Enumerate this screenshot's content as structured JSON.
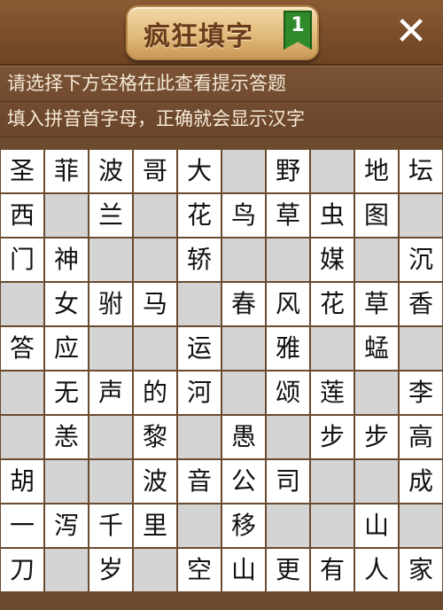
{
  "header": {
    "title": "疯狂填字",
    "level": "1",
    "close_label": "✕"
  },
  "hints": [
    "请选择下方空格在此查看提示答题",
    "填入拼音首字母，正确就会显示汉字"
  ],
  "grid": [
    [
      "圣",
      "菲",
      "波",
      "哥",
      "大",
      null,
      "野",
      null,
      "地",
      "坛"
    ],
    [
      "西",
      null,
      "兰",
      null,
      "花",
      "鸟",
      "草",
      "虫",
      "图",
      null
    ],
    [
      "门",
      "神",
      null,
      null,
      "轿",
      null,
      null,
      "媒",
      null,
      "沉"
    ],
    [
      null,
      "女",
      "驸",
      "马",
      null,
      "春",
      "风",
      "花",
      "草",
      "香"
    ],
    [
      "答",
      "应",
      null,
      null,
      "运",
      null,
      "雅",
      null,
      "蜢",
      null
    ],
    [
      null,
      "无",
      "声",
      "的",
      "河",
      null,
      "颂",
      "莲",
      null,
      "李"
    ],
    [
      null,
      "恙",
      null,
      "黎",
      null,
      "愚",
      null,
      "步",
      "步",
      "高"
    ],
    [
      "胡",
      null,
      null,
      "波",
      "音",
      "公",
      "司",
      null,
      null,
      "成"
    ],
    [
      "一",
      "泻",
      "千",
      "里",
      null,
      "移",
      null,
      null,
      "山",
      null
    ],
    [
      "刀",
      null,
      "岁",
      null,
      "空",
      "山",
      "更",
      "有",
      "人",
      "家"
    ]
  ],
  "colors": {
    "open": "#ffffff",
    "blocked": "#d4d4d4",
    "frame": "#6b4a2e"
  }
}
